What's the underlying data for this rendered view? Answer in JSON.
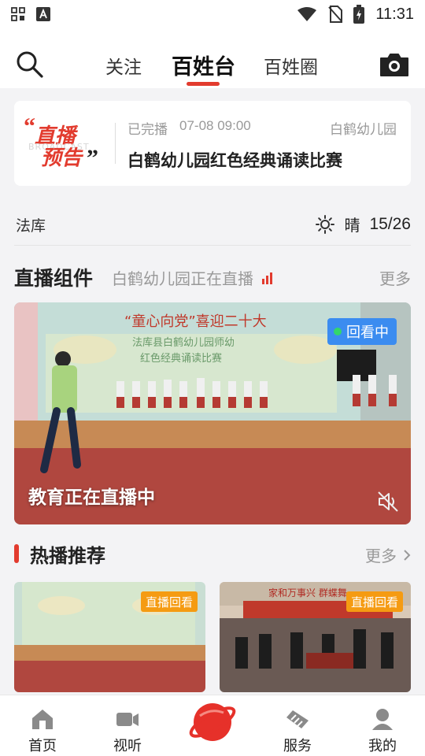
{
  "status_bar": {
    "time": "11:31"
  },
  "top_nav": {
    "tabs": [
      {
        "label": "关注"
      },
      {
        "label": "百姓台",
        "active": true
      },
      {
        "label": "百姓圈"
      }
    ],
    "accent_color": "#e23b2e"
  },
  "live_preview": {
    "logo_line1": "直播",
    "logo_line2": "预告",
    "logo_watermark": "BROADCAST",
    "status": "已完播",
    "time": "07-08 09:00",
    "source": "白鹤幼儿园",
    "title": "白鹤幼儿园红色经典诵读比赛"
  },
  "location": {
    "name": "法库",
    "weather_icon": "sun-icon",
    "weather": "晴",
    "temperature": "15/26"
  },
  "live_section": {
    "title": "直播组件",
    "subtitle": "白鹤幼儿园正在直播",
    "more": "更多",
    "video": {
      "badge": "回看中",
      "caption": "教育正在直播中",
      "banner_text": "“童心向党”喜迎二十大",
      "stage_text_1": "法库县白鹤幼儿园师幼",
      "stage_text_2": "红色经典诵读比赛"
    }
  },
  "hot_section": {
    "title": "热播推荐",
    "more": "更多",
    "items": [
      {
        "badge": "直播回看"
      },
      {
        "badge": "直播回看",
        "banner_text": "家和万事兴 群蝶舞"
      }
    ]
  },
  "bottom_nav": {
    "items": [
      {
        "label": "首页",
        "icon": "home-icon"
      },
      {
        "label": "视听",
        "icon": "video-icon"
      },
      {
        "label": "",
        "icon": "planet-icon"
      },
      {
        "label": "服务",
        "icon": "handshake-icon"
      },
      {
        "label": "我的",
        "icon": "user-icon"
      }
    ]
  }
}
